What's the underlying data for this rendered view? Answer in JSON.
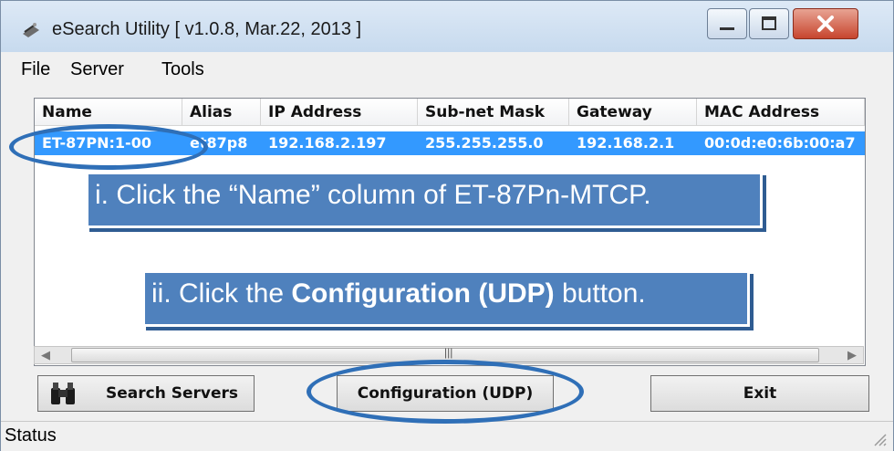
{
  "window": {
    "title": "eSearch Utility [ v1.0.8, Mar.22, 2013 ]"
  },
  "menu": {
    "items": [
      "File",
      "Server",
      "Tools"
    ]
  },
  "table": {
    "columns": [
      "Name",
      "Alias",
      "IP Address",
      "Sub-net Mask",
      "Gateway",
      "MAC Address"
    ],
    "rows": [
      [
        "ET-87PN:1-00",
        "et87p8",
        "192.168.2.197",
        "255.255.255.0",
        "192.168.2.1",
        "00:0d:e0:6b:00:a7"
      ]
    ]
  },
  "buttons": {
    "search_servers": "Search Servers",
    "configuration": "Configuration (UDP)",
    "exit": "Exit"
  },
  "status": {
    "text": "Status"
  },
  "callouts": {
    "step1": "i. Click the “Name” column of ET-87Pn-MTCP.",
    "step2_prefix": "ii. Click the ",
    "step2_bold": "Configuration (UDP)",
    "step2_suffix": " button."
  },
  "colors": {
    "selection": "#3399ff",
    "callout": "#4f81bd",
    "ellipse": "#2f6fb7"
  },
  "icons": [
    "app-icon",
    "minimize-icon",
    "maximize-icon",
    "close-icon",
    "binoculars-icon",
    "scroll-left-icon",
    "scroll-right-icon",
    "resize-grip-icon"
  ]
}
